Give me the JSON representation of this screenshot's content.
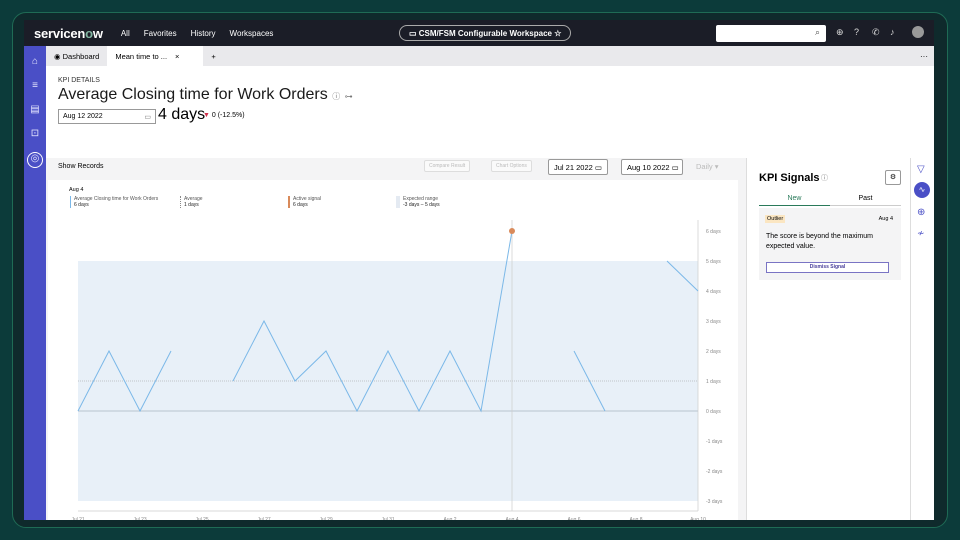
{
  "topbar": {
    "logo": "servicenow",
    "nav": [
      "All",
      "Favorites",
      "History",
      "Workspaces"
    ],
    "workspace": "CSM/FSM Configurable Workspace"
  },
  "tabs": [
    {
      "label": "Dashboard"
    },
    {
      "label": "Mean time to ..."
    }
  ],
  "kpi": {
    "section": "KPI DETAILS",
    "title": "Average Closing time for Work Orders",
    "date": "Aug 12 2022",
    "value": "4 days",
    "delta": "0 (-12.5%)"
  },
  "toolbar": {
    "show_records": "Show Records",
    "compare": "Compare Result",
    "chart_options": "Chart Options",
    "start": "Jul 21 2022",
    "end": "Aug 10 2022",
    "period": "Daily"
  },
  "legend": {
    "date": "Aug 4",
    "series_label": "Average Closing time for Work Orders",
    "series_value": "6 days",
    "avg_label": "Average",
    "avg_value": "1 days",
    "signal_label": "Active signal",
    "signal_value": "6 days",
    "range_label": "Expected range",
    "range_value": "-3 days – 5 days"
  },
  "chart_data": {
    "type": "line",
    "x": [
      "Jul 21",
      "Jul 22",
      "Jul 23",
      "Jul 24",
      "Jul 25",
      "Jul 26",
      "Jul 27",
      "Jul 28",
      "Jul 29",
      "Jul 30",
      "Jul 31",
      "Aug 1",
      "Aug 2",
      "Aug 3",
      "Aug 4",
      "Aug 5",
      "Aug 6",
      "Aug 7",
      "Aug 8",
      "Aug 9",
      "Aug 10"
    ],
    "values": [
      0,
      2,
      0,
      2,
      null,
      1,
      3,
      1,
      2,
      0,
      2,
      0,
      2,
      0,
      6,
      null,
      2,
      0,
      null,
      5,
      4
    ],
    "average": 1,
    "expected_range": [
      -3,
      5
    ],
    "signal_index": 14,
    "ylim": [
      -3,
      6
    ],
    "xticks": [
      "Jul 21",
      "Jul 23",
      "Jul 25",
      "Jul 27",
      "Jul 29",
      "Jul 31",
      "Aug 2",
      "Aug 4",
      "Aug 6",
      "Aug 8",
      "Aug 10"
    ],
    "yticks": [
      "6 days",
      "5 days",
      "4 days",
      "3 days",
      "2 days",
      "1 days",
      "0 days",
      "-1 days",
      "-2 days",
      "-3 days"
    ],
    "colors": {
      "line": "#7bb8e8",
      "band": "#e8f0f8",
      "signal": "#d98a5a"
    }
  },
  "signals": {
    "title": "KPI Signals",
    "tabs": [
      "New",
      "Past"
    ],
    "badge": "Outlier",
    "date": "Aug 4",
    "text": "The score is beyond the maximum expected value.",
    "dismiss": "Dismiss Signal"
  }
}
